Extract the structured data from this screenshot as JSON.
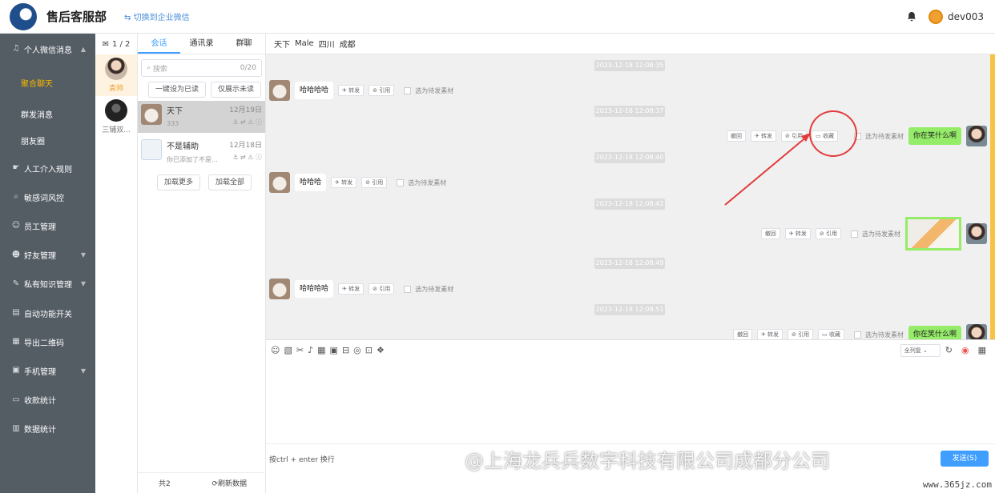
{
  "header": {
    "app_title": "售后客服部",
    "switch_link": "⇆ 切换到企业微信",
    "username": "dev003"
  },
  "sidebar": {
    "items": [
      {
        "label": "个人微信消息",
        "icon": "bell-icon"
      },
      {
        "label": "聚合聊天",
        "sub": true,
        "active": true
      },
      {
        "label": "群发消息",
        "sub": true
      },
      {
        "label": "朋友圈",
        "sub": true
      },
      {
        "label": "人工介入规则",
        "icon": "hand-icon"
      },
      {
        "label": "敏感词风控",
        "icon": "search-icon"
      },
      {
        "label": "员工管理",
        "icon": "user-icon"
      },
      {
        "label": "好友管理",
        "icon": "friends-icon"
      },
      {
        "label": "私有知识管理",
        "icon": "book-icon"
      },
      {
        "label": "自动功能开关",
        "icon": "switch-icon"
      },
      {
        "label": "导出二维码",
        "icon": "qrcode-icon"
      },
      {
        "label": "手机管理",
        "icon": "phone-icon"
      },
      {
        "label": "收款统计",
        "icon": "wallet-icon"
      },
      {
        "label": "数据统计",
        "icon": "chart-icon"
      }
    ]
  },
  "contacts": {
    "counter": "1 / 2",
    "items": [
      {
        "name": "袁帅",
        "active": true
      },
      {
        "name": "三铺双..."
      }
    ]
  },
  "convlist": {
    "tabs": [
      "会话",
      "通讯录",
      "群聊"
    ],
    "search_placeholder": "搜索",
    "search_count": "0/20",
    "btn_mark_read": "一键设为已读",
    "btn_unread_only": "仅展示未读",
    "items": [
      {
        "name": "天下",
        "preview": "333",
        "date": "12月19日",
        "icons": "⚓ ⇄ ⚠ ⓘ"
      },
      {
        "name": "不是辅助",
        "preview": "你已添加了不是...",
        "date": "12月18日",
        "icons": "⚓ ⇄ ⚠ ⓘ"
      }
    ],
    "btn_load_more": "加载更多",
    "btn_load_all": "加载全部",
    "total": "共2",
    "refresh": "⟳刷新数据"
  },
  "chat": {
    "header": [
      "天下",
      "Male",
      "四川",
      "成都"
    ],
    "timestamps": [
      "2023-12-18 12:08:35",
      "2023-12-18 12:08:37",
      "2023-12-18 12:08:40",
      "2023-12-18 12:08:42",
      "2023-12-18 12:08:49",
      "2023-12-18 12:08:51"
    ],
    "msg1": "哈哈哈哈",
    "msg2": "你在笑什么啊",
    "msg3": "哈哈哈",
    "msg5": "哈哈哈哈",
    "msg6": "你在笑什么啊",
    "chip_forward": "✈ 转发",
    "chip_quote": "⊘ 引用",
    "chip_recall": "撤回",
    "chip_collect": "▭ 收藏",
    "check_label": "选为待发素材",
    "select_label": "全列复",
    "hint": "按ctrl + enter 换行",
    "send": "发送(S)"
  },
  "watermark": "@上海龙兵兵数字科技有限公司成都分公司",
  "site": "www.365jz.com",
  "colors": {
    "sidebar_bg": "#545c64",
    "active_menu": "#f5b800",
    "accent": "#409eff",
    "self_bubble": "#95ec69",
    "annotation": "#e23b3b"
  }
}
